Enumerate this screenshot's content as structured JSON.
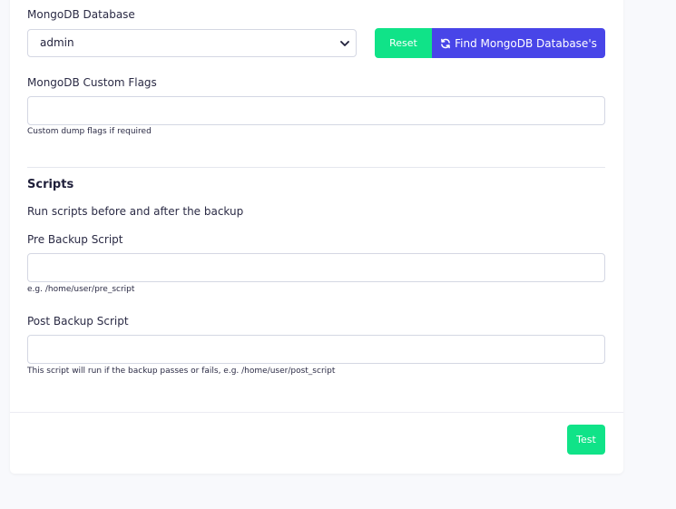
{
  "database": {
    "label": "MongoDB Database",
    "selected": "admin",
    "reset_label": "Reset",
    "find_label": "Find MongoDB Database's",
    "find_icon": "refresh-icon",
    "select_icon": "chevron-down-icon"
  },
  "custom_flags": {
    "label": "MongoDB Custom Flags",
    "value": "",
    "help": "Custom dump flags if required"
  },
  "scripts": {
    "title": "Scripts",
    "description": "Run scripts before and after the backup",
    "pre": {
      "label": "Pre Backup Script",
      "value": "",
      "help": "e.g. /home/user/pre_script"
    },
    "post": {
      "label": "Post Backup Script",
      "value": "",
      "help": "This script will run if the backup passes or fails, e.g. /home/user/post_script"
    }
  },
  "footer": {
    "test_label": "Test"
  },
  "colors": {
    "accent_green": "#10e388",
    "accent_purple": "#4845e8"
  }
}
